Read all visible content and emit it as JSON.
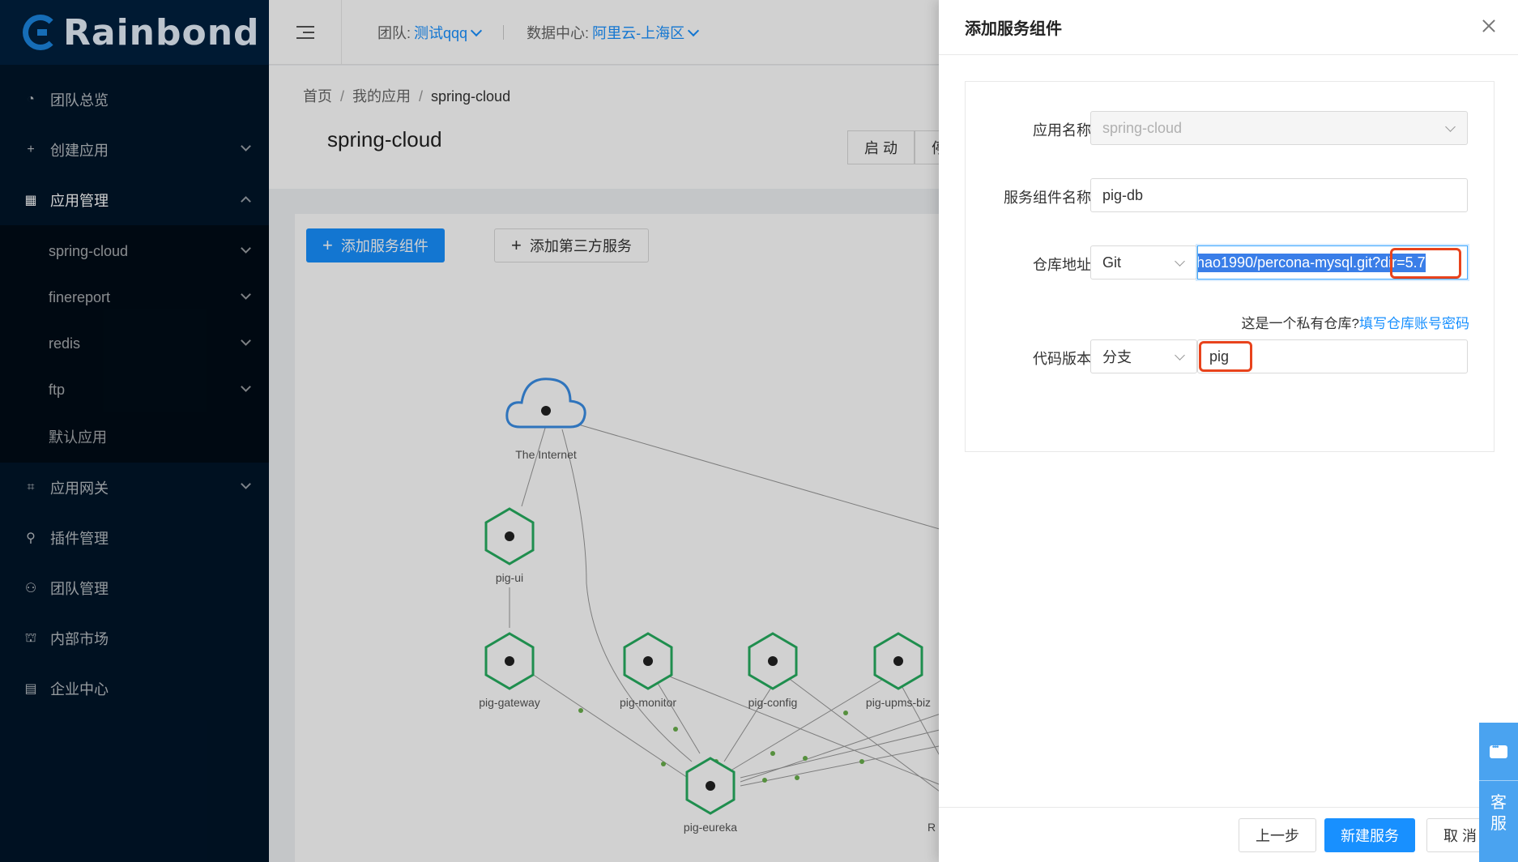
{
  "app": {
    "logo": "Rainbond"
  },
  "header": {
    "team_label": "团队:",
    "team_value": "测试qqq",
    "dc_label": "数据中心:",
    "dc_value": "阿里云-上海区"
  },
  "sidebar": {
    "items": [
      {
        "label": "团队总览",
        "icon": "dashboard-icon"
      },
      {
        "label": "创建应用",
        "icon": "plus-icon"
      },
      {
        "label": "应用管理",
        "icon": "grid-icon"
      },
      {
        "label": "应用网关",
        "icon": "gateway-icon"
      },
      {
        "label": "插件管理",
        "icon": "plugin-icon"
      },
      {
        "label": "团队管理",
        "icon": "team-icon"
      },
      {
        "label": "内部市场",
        "icon": "market-icon"
      },
      {
        "label": "企业中心",
        "icon": "enterprise-icon"
      }
    ],
    "apps": [
      "spring-cloud",
      "finereport",
      "redis",
      "ftp",
      "默认应用"
    ]
  },
  "breadcrumb": [
    "首页",
    "我的应用",
    "spring-cloud"
  ],
  "page": {
    "title": "spring-cloud",
    "btn_start": "启 动",
    "btn_stop": "停"
  },
  "toolbar": {
    "add_component": "添加服务组件",
    "add_third_party": "添加第三方服务"
  },
  "topology": {
    "nodes": [
      {
        "id": "internet",
        "label": "The Internet"
      },
      {
        "id": "pig-ui",
        "label": "pig-ui"
      },
      {
        "id": "pig-gateway",
        "label": "pig-gateway"
      },
      {
        "id": "pig-monitor",
        "label": "pig-monitor"
      },
      {
        "id": "pig-config",
        "label": "pig-config"
      },
      {
        "id": "pig-upms-biz",
        "label": "pig-upms-biz"
      },
      {
        "id": "pig-eureka",
        "label": "pig-eureka"
      },
      {
        "id": "partial",
        "label": "R"
      }
    ]
  },
  "drawer": {
    "title": "添加服务组件",
    "app_name_label": "应用名称:",
    "app_name_value": "spring-cloud",
    "component_name_label": "服务组件名称:",
    "component_name_value": "pig-db",
    "repo_label": "仓库地址:",
    "repo_type": "Git",
    "repo_value": "hao1990/percona-mysql.git?dir=5.7",
    "private_hint": "这是一个私有仓库?",
    "private_link": "填写仓库账号密码",
    "version_label": "代码版本:",
    "version_type": "分支",
    "version_value": "pig",
    "btn_prev": "上一步",
    "btn_create": "新建服务",
    "btn_cancel": "取 消"
  },
  "support": {
    "label_1": "客",
    "label_2": "服"
  }
}
